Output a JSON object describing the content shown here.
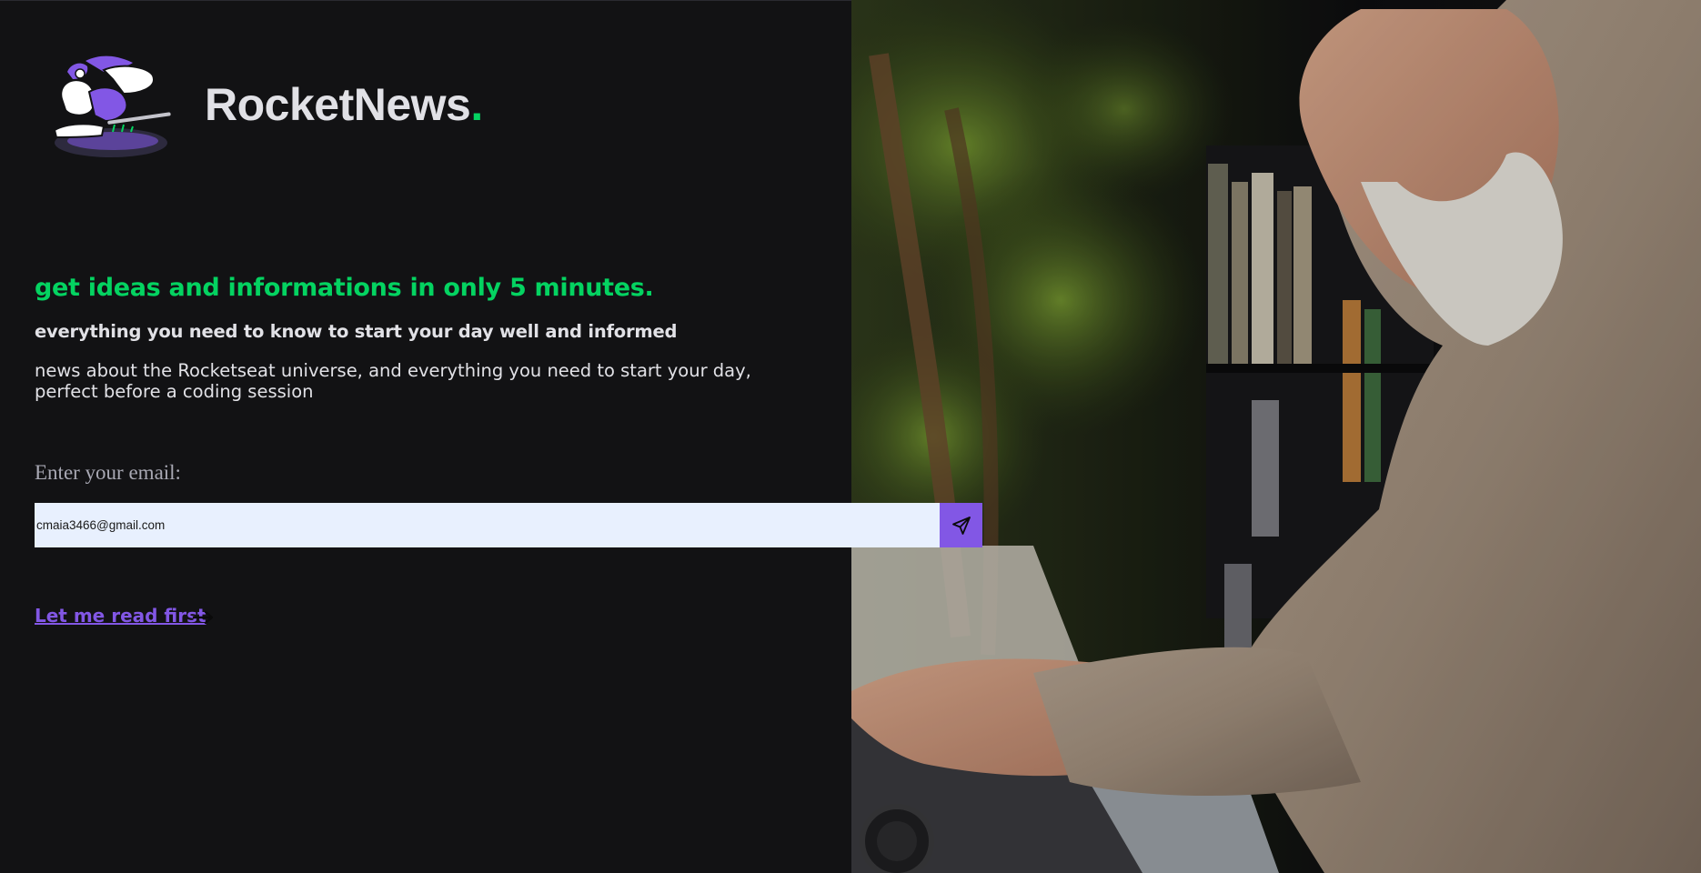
{
  "brand": {
    "name": "RocketNews",
    "dot": ".",
    "dot_color": "#04d361"
  },
  "hero": {
    "headline": "get ideas and informations in only 5 minutes.",
    "subheadline": "everything you need to know to start your day well and informed",
    "description_line1": "news about the Rocketseat universe, and everything you need to start your day,",
    "description_line2": "perfect before a coding session"
  },
  "form": {
    "email_label": "Enter your email:",
    "email_value": "cmaia3466@gmail.com",
    "send_icon": "send-icon"
  },
  "read_first": {
    "label": "Let me read first",
    "icon": "arrow-right-icon"
  },
  "colors": {
    "background": "#121214",
    "accent_green": "#04d361",
    "accent_purple": "#8257e5",
    "text": "#e1e1e6",
    "input_bg": "#e8f0fe"
  }
}
